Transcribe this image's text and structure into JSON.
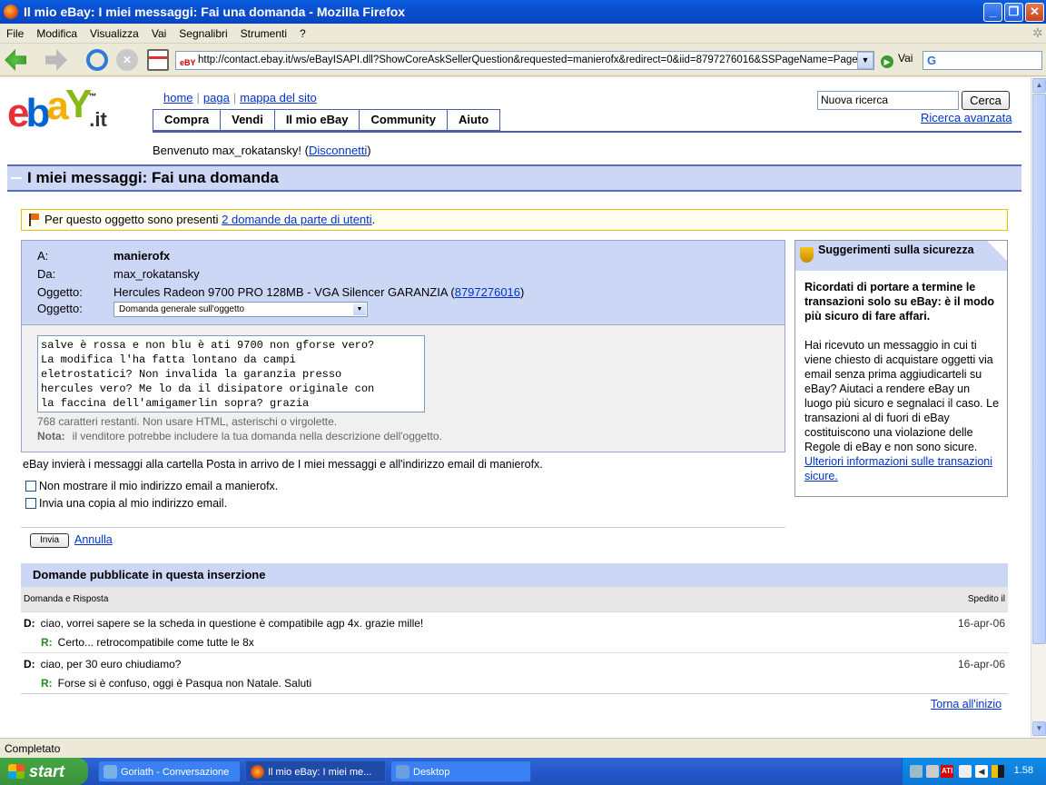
{
  "window": {
    "title": "Il mio eBay: I miei messaggi: Fai una domanda - Mozilla Firefox"
  },
  "menu": [
    "File",
    "Modifica",
    "Visualizza",
    "Vai",
    "Segnalibri",
    "Strumenti",
    "?"
  ],
  "toolbar": {
    "url": "http://contact.ebay.it/ws/eBayISAPI.dll?ShowCoreAskSellerQuestion&requested=manierofx&redirect=0&iid=8797276016&SSPageName=PageAskSel",
    "favicon": "eBY",
    "go_label": "Vai",
    "search_logo": "G"
  },
  "ebay": {
    "logo": {
      "e": "e",
      "b": "b",
      "a": "a",
      "y": "Y",
      "tm": "™",
      "tld": ".it"
    },
    "toplinks": [
      "home",
      "paga",
      "mappa del sito"
    ],
    "nav": [
      "Compra",
      "Vendi",
      "Il mio eBay",
      "Community",
      "Aiuto"
    ],
    "search": {
      "value": "Nuova ricerca",
      "button": "Cerca",
      "advanced": "Ricerca avanzata"
    },
    "welcome": {
      "text": "Benvenuto max_rokatansky! (",
      "logout": "Disconnetti",
      "close": ")"
    },
    "page_title": "I miei messaggi: Fai una domanda",
    "notice": {
      "text": "Per questo oggetto sono presenti",
      "link": "2 domande da parte di utenti",
      "end": "."
    },
    "form": {
      "to_label": "A:",
      "to_value": "manierofx",
      "from_label": "Da:",
      "from_value": "max_rokatansky",
      "item_label": "Oggetto:",
      "item_value": "Hercules Radeon 9700 PRO 128MB - VGA Silencer GARANZIA (",
      "item_id": "8797276016",
      "item_close": ")",
      "subject_label": "Oggetto:",
      "subject_value": "Domanda generale sull'oggetto",
      "message": "salve è rossa e non blu è ati 9700 non gforse vero?\nLa modifica l'ha fatta lontano da campi\neletrostatici? Non invalida la garanzia presso\nhercules vero? Me lo da il disipatore originale con\nla faccina dell'amigamerlin sopra? grazia",
      "remaining": "768 caratteri restanti. Non usare HTML, asterischi o virgolette.",
      "nota_label": "Nota:",
      "nota_text": "il venditore potrebbe includere la tua domanda nella descrizione dell'oggetto."
    },
    "info": "eBay invierà i messaggi alla cartella Posta in arrivo de I miei messaggi e all'indirizzo email di manierofx.",
    "checkbox1": "Non mostrare il mio indirizzo email a manierofx.",
    "checkbox2": "Invia una copia al mio indirizzo email.",
    "send": "Invia",
    "cancel": "Annulla",
    "tips": {
      "title": "Suggerimenti sulla sicurezza",
      "bold": "Ricordati di portare a termine le transazioni solo su eBay: è il modo più sicuro di fare affari.",
      "body": "Hai ricevuto un messaggio in cui ti viene chiesto di acquistare oggetti via email senza prima aggiudicarteli su eBay? Aiutaci a rendere eBay un luogo più sicuro e segnalaci il caso. Le transazioni al di fuori di eBay costituiscono una violazione delle Regole di eBay e non sono sicure.",
      "link": "Ulteriori informazioni sulle transazioni sicure."
    },
    "qa": {
      "title": "Domande pubblicate in questa inserzione",
      "col1": "Domanda e Risposta",
      "col2": "Spedito il",
      "q_label": "D:",
      "a_label": "R:",
      "items": [
        {
          "q": "ciao, vorrei sapere se la scheda in questione è compatibile agp 4x. grazie mille!",
          "date": "16-apr-06",
          "a": "Certo... retrocompatibile come tutte le 8x"
        },
        {
          "q": "ciao, per 30 euro chiudiamo?",
          "date": "16-apr-06",
          "a": "Forse si è confuso, oggi è Pasqua non Natale. Saluti"
        }
      ]
    },
    "back_top": "Torna all'inizio"
  },
  "status": "Completato",
  "taskbar": {
    "start": "start",
    "tasks": [
      "Goriath - Conversazione",
      "Il mio eBay: I miei me...",
      "Desktop"
    ],
    "clock": "1.58",
    "tray_ati": "ATI"
  }
}
